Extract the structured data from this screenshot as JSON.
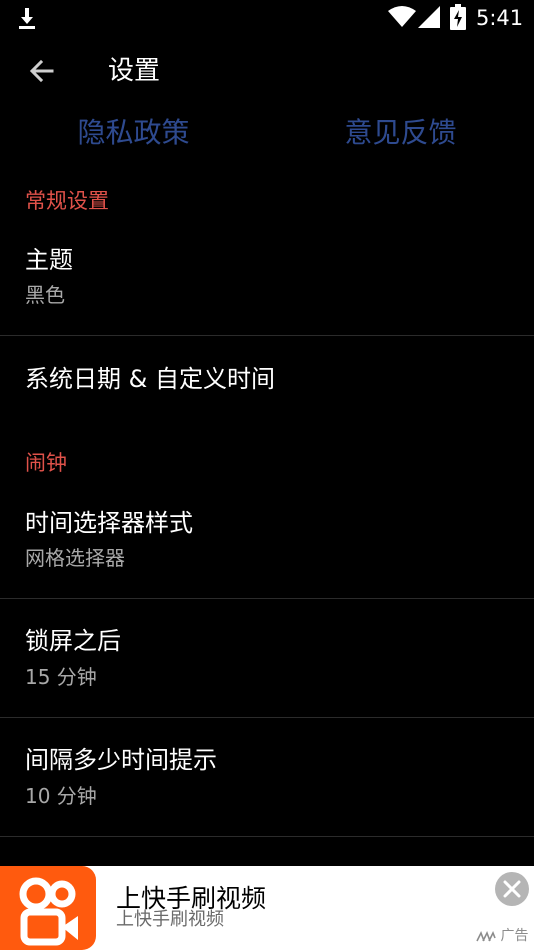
{
  "status_bar": {
    "time": "5:41",
    "icons": [
      "download-icon",
      "wifi-icon",
      "signal-icon",
      "battery-charging-icon"
    ]
  },
  "toolbar": {
    "title": "设置",
    "back_icon": "arrow-left-icon"
  },
  "top_links": {
    "privacy": "隐私政策",
    "feedback": "意见反馈"
  },
  "sections": {
    "general": {
      "header": "常规设置",
      "theme": {
        "title": "主题",
        "value": "黑色"
      },
      "system_date": {
        "title": "系统日期 & 自定义时间"
      }
    },
    "alarm": {
      "header": "闹钟",
      "time_picker": {
        "title": "时间选择器样式",
        "value": "网格选择器"
      },
      "after_lock": {
        "title": "锁屏之后",
        "value": "15 分钟"
      },
      "interval": {
        "title": "间隔多少时间提示",
        "value": "10 分钟"
      }
    }
  },
  "ad": {
    "title": "上快手刷视频",
    "subtitle": "上快手刷视频",
    "mark": "广告",
    "icons": [
      "kuaishou-logo-icon",
      "close-icon"
    ]
  },
  "colors": {
    "background": "#000000",
    "section_header": "#e0524a",
    "link": "#2e4a8f",
    "subtitle": "#a8a8a8",
    "ad_logo": "#ff5a0e"
  }
}
